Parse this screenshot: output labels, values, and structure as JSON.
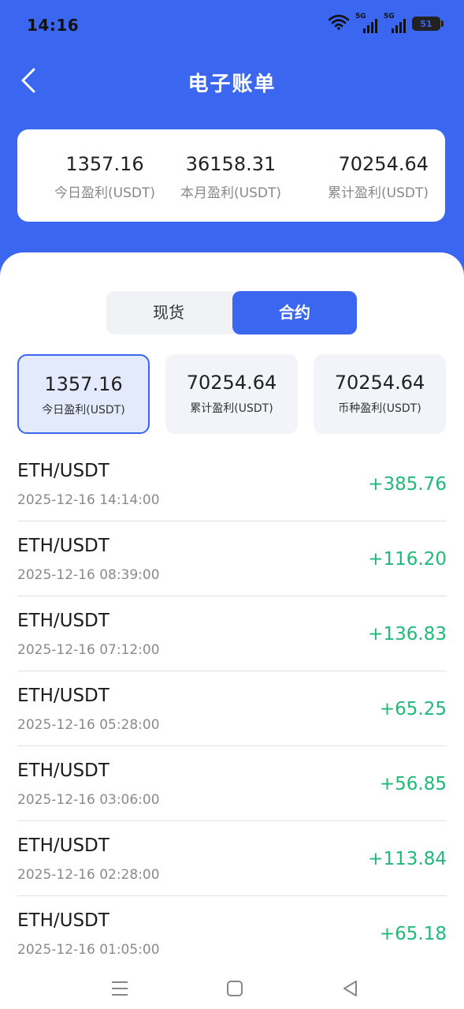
{
  "status_bar": {
    "time": "14:16",
    "network_1": "5G",
    "network_2": "5G",
    "battery": "51",
    "icons": [
      "wifi-icon",
      "signal-icon",
      "signal-icon",
      "battery-icon"
    ]
  },
  "header": {
    "title": "电子账单",
    "back_icon": "chevron-left-icon"
  },
  "summary": [
    {
      "value": "1357.16",
      "label": "今日盈利(USDT)"
    },
    {
      "value": "36158.31",
      "label": "本月盈利(USDT)"
    },
    {
      "value": "70254.64",
      "label": "累计盈利(USDT)"
    }
  ],
  "tabs": {
    "spot": "现货",
    "contract": "合约",
    "selected": "合约"
  },
  "stats": [
    {
      "value": "1357.16",
      "label": "今日盈利(USDT)",
      "active": true
    },
    {
      "value": "70254.64",
      "label": "累计盈利(USDT)",
      "active": false
    },
    {
      "value": "70254.64",
      "label": "币种盈利(USDT)",
      "active": false
    }
  ],
  "records": [
    {
      "pair": "ETH/USDT",
      "time": "2025-12-16 14:14:00",
      "amount": "+385.76"
    },
    {
      "pair": "ETH/USDT",
      "time": "2025-12-16 08:39:00",
      "amount": "+116.20"
    },
    {
      "pair": "ETH/USDT",
      "time": "2025-12-16 07:12:00",
      "amount": "+136.83"
    },
    {
      "pair": "ETH/USDT",
      "time": "2025-12-16 05:28:00",
      "amount": "+65.25"
    },
    {
      "pair": "ETH/USDT",
      "time": "2025-12-16 03:06:00",
      "amount": "+56.85"
    },
    {
      "pair": "ETH/USDT",
      "time": "2025-12-16 02:28:00",
      "amount": "+113.84"
    },
    {
      "pair": "ETH/USDT",
      "time": "2025-12-16 01:05:00",
      "amount": "+65.18"
    }
  ],
  "colors": {
    "primary": "#3a66f0",
    "profit": "#1fb97a"
  },
  "nav": {
    "icons": [
      "menu-icon",
      "home-square-icon",
      "back-triangle-icon"
    ]
  }
}
